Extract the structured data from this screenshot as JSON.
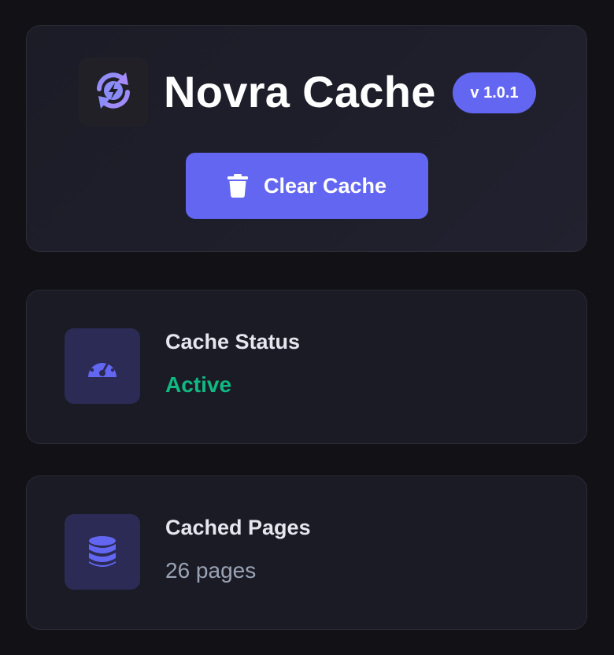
{
  "header": {
    "app_name": "Novra Cache",
    "version": "v 1.0.1",
    "logo_icon": "refresh-bolt-icon"
  },
  "actions": {
    "clear_cache_label": "Clear Cache",
    "clear_cache_icon": "trash-icon"
  },
  "stats": {
    "status": {
      "label": "Cache Status",
      "value": "Active",
      "icon": "gauge-icon",
      "value_color": "#10b981"
    },
    "pages": {
      "label": "Cached Pages",
      "value": "26 pages",
      "icon": "database-icon"
    }
  },
  "colors": {
    "accent": "#6366f1",
    "background": "#111116",
    "card": "#1b1b25",
    "success": "#10b981"
  }
}
